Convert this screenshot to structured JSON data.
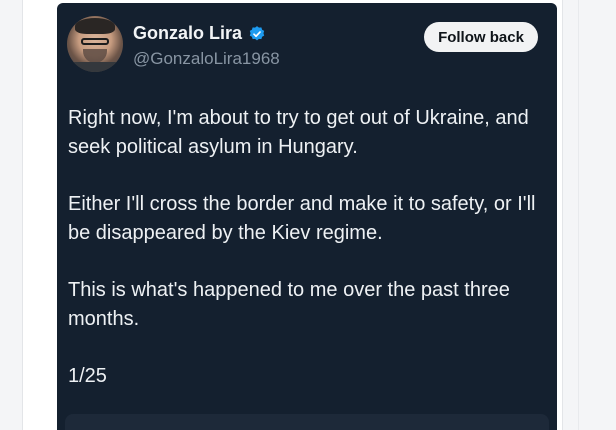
{
  "tweet": {
    "display_name": "Gonzalo Lira",
    "handle": "@GonzaloLira1968",
    "follow_label": "Follow back",
    "avatar_icon": "user-avatar",
    "verified_icon": "verified-badge-icon",
    "verified_color": "#1d9bf0",
    "paragraphs": [
      "Right now, I'm about to try to get out of Ukraine, and seek political asylum in Hungary.",
      "Either I'll cross the border and make it to safety, or I'll be disappeared by the Kiev regime.",
      "This is what's happened to me over the past three months.",
      "1/25"
    ]
  },
  "colors": {
    "card_background": "#14202f",
    "button_background": "#f2f3f4",
    "handle_text": "#8895a3"
  }
}
